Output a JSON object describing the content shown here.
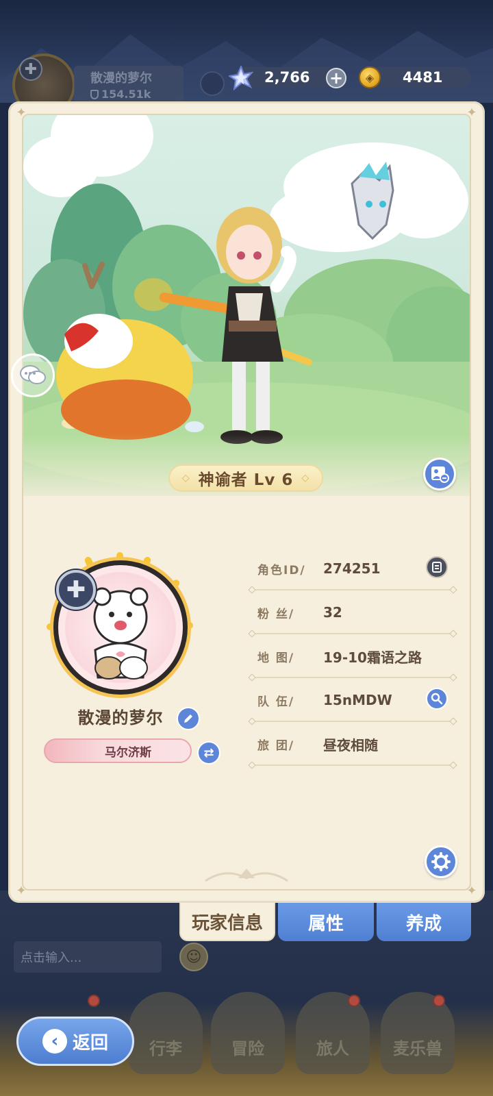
{
  "hud": {
    "player_name": "散漫的萝尔",
    "power": "154.51k",
    "gems": "2,766",
    "coins": "4481",
    "plus_label": "+"
  },
  "scene": {
    "level_label": "神谕者 Lv 6"
  },
  "profile": {
    "name": "散漫的萝尔",
    "title_badge": "马尔济斯"
  },
  "info": {
    "rows": [
      {
        "label": "角色ID/",
        "value": "274251"
      },
      {
        "label": "粉  丝/",
        "value": "32"
      },
      {
        "label": "地  图/",
        "value": "19-10霜语之路"
      },
      {
        "label": "队  伍/",
        "value": "15nMDW"
      },
      {
        "label": "旅  团/",
        "value": "昼夜相随"
      }
    ]
  },
  "tabs": {
    "player_info": "玩家信息",
    "attributes": "属性",
    "growth": "养成"
  },
  "chat": {
    "placeholder": "点击输入..."
  },
  "nav": {
    "back": "返回",
    "bag": "行李",
    "adventure": "冒险",
    "traveler": "旅人",
    "pets": "麦乐兽"
  },
  "icons": {
    "gem": "star-gem-icon",
    "coin": "gold-coin-icon",
    "photo": "photo-card-icon",
    "chat": "chat-bubbles-icon",
    "edit": "pencil-icon",
    "swap": "swap-arrows-icon",
    "copy": "copy-icon",
    "search": "magnifier-icon",
    "settings": "gear-icon"
  },
  "colors": {
    "card_bg": "#f6efde",
    "accent_blue": "#5d86d8",
    "level_plate": "#f2e1a8",
    "title_pink": "#f2b7bd"
  }
}
